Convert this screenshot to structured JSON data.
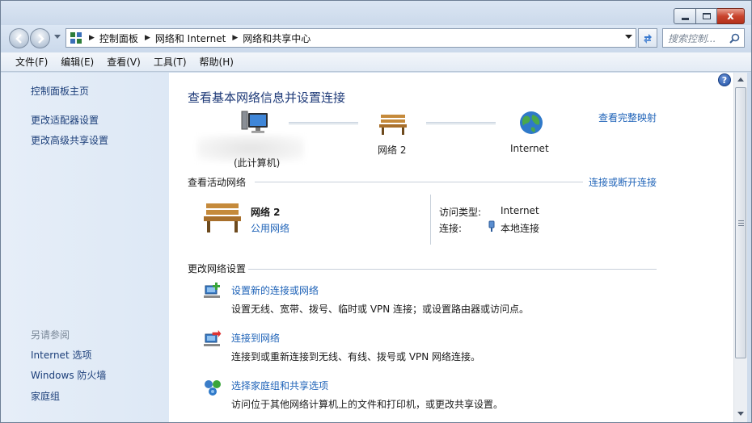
{
  "address": {
    "crumbs": [
      "控制面板",
      "网络和 Internet",
      "网络和共享中心"
    ]
  },
  "search": {
    "placeholder": "搜索控制..."
  },
  "menu": [
    "文件(F)",
    "编辑(E)",
    "查看(V)",
    "工具(T)",
    "帮助(H)"
  ],
  "sidebar": {
    "items": [
      "控制面板主页",
      "更改适配器设置",
      "更改高级共享设置"
    ],
    "see_also_heading": "另请参阅",
    "see_also": [
      "Internet 选项",
      "Windows 防火墙",
      "家庭组"
    ]
  },
  "main": {
    "title": "查看基本网络信息并设置连接",
    "map_link": "查看完整映射",
    "map": {
      "computer_label": "(此计算机)",
      "network_label": "网络  2",
      "internet_label": "Internet"
    },
    "active_section": {
      "title": "查看活动网络",
      "connect_link": "连接或断开连接",
      "network_name": "网络  2",
      "network_type": "公用网络",
      "access_type_key": "访问类型:",
      "access_type_value": "Internet",
      "connection_key": "连接:",
      "connection_value": "本地连接"
    },
    "change_section": {
      "title": "更改网络设置",
      "tasks": [
        {
          "link": "设置新的连接或网络",
          "desc": "设置无线、宽带、拨号、临时或 VPN 连接；或设置路由器或访问点。"
        },
        {
          "link": "连接到网络",
          "desc": "连接到或重新连接到无线、有线、拨号或 VPN 网络连接。"
        },
        {
          "link": "选择家庭组和共享选项",
          "desc": "访问位于其他网络计算机上的文件和打印机，或更改共享设置。"
        }
      ]
    }
  },
  "help_icon": "?",
  "caption": {
    "close": "x"
  },
  "colors": {
    "link": "#1f63b8",
    "title": "#1e3a78",
    "sidebar_bg": "#e3ecf7"
  }
}
